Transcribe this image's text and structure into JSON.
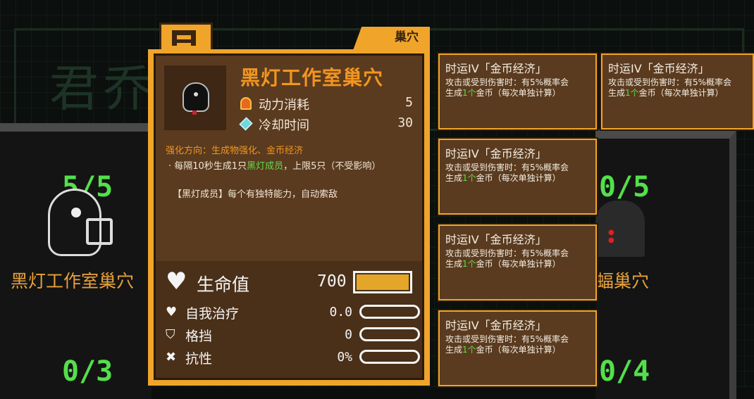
{
  "background": {
    "faded_title": "君乔",
    "left_slot": {
      "count": "5/5",
      "name": "黑灯工作室巢穴"
    },
    "right_slot": {
      "count": "0/5",
      "name_fragment": "蝠巢穴"
    },
    "bottom_left_count": "0/3",
    "bottom_right_count": "0/4"
  },
  "panel": {
    "category": "巢穴",
    "building_name": "黑灯工作室巢穴",
    "stats": [
      {
        "icon": "power-flame-icon",
        "label": "动力消耗",
        "value": "5"
      },
      {
        "icon": "cooldown-crystal-icon",
        "label": "冷却时间",
        "value": "30"
      }
    ],
    "enhance_direction": "强化方向：生成物强化、金币经济",
    "description": {
      "prefix": "· 每隔10秒生成1只",
      "highlight": "黑灯成员",
      "suffix": "，上限5只（不受影响）"
    },
    "member_note": "【黑灯成员】每个有独特能力，自动索敌",
    "hp": {
      "label": "生命值",
      "value": "700",
      "fill": 1.0
    },
    "sub_stats": [
      {
        "icon": "self-heal-icon",
        "label": "自我治疗",
        "value": "0.0",
        "fill": 0
      },
      {
        "icon": "block-shield-icon",
        "label": "格挡",
        "value": "0",
        "fill": 0
      },
      {
        "icon": "resistance-icon",
        "label": "抗性",
        "value": "0%",
        "fill": 0
      }
    ]
  },
  "cards": [
    {
      "title": "时运IV「金币经济」",
      "line1": "攻击或受到伤害时：有5%概率会",
      "line2_pre": "生成",
      "line2_hl": "1个",
      "line2_post": "金币（每次单独计算）"
    },
    {
      "title": "时运IV「金币经济」",
      "line1": "攻击或受到伤害时：有5%概率会",
      "line2_pre": "生成",
      "line2_hl": "1个",
      "line2_post": "金币（每次单独计算）"
    },
    {
      "title": "时运IV「金币经济」",
      "line1": "攻击或受到伤害时：有5%概率会",
      "line2_pre": "生成",
      "line2_hl": "1个",
      "line2_post": "金币（每次单独计算）"
    },
    {
      "title": "时运IV「金币经济」",
      "line1": "攻击或受到伤害时：有5%概率会",
      "line2_pre": "生成",
      "line2_hl": "1个",
      "line2_post": "金币（每次单独计算）"
    },
    {
      "title": "时运IV「金币经济」",
      "line1": "攻击或受到伤害时：有5%概率会",
      "line2_pre": "生成",
      "line2_hl": "1个",
      "line2_post": "金币（每次单独计算）"
    }
  ],
  "colors": {
    "accent_orange": "#f0a52a",
    "panel_brown": "#5a3b1f",
    "highlight_green": "#5fdc4a",
    "counter_green": "#53e04a",
    "hp_bar": "#e3a629"
  }
}
